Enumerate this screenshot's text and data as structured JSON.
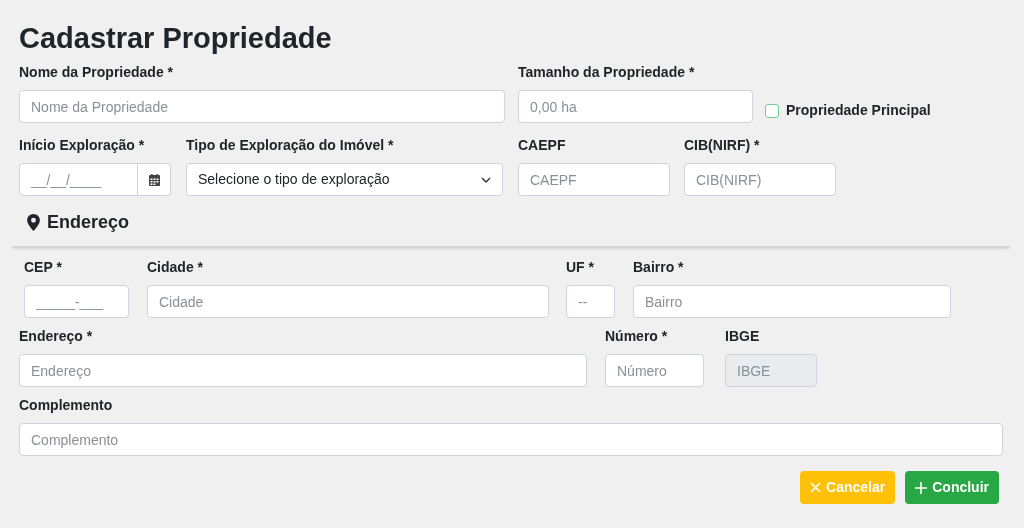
{
  "title": "Cadastrar Propriedade",
  "rows": [
    [
      {
        "kind": "text",
        "label": "Nome da Propriedade *",
        "placeholder": "Nome da Propriedade",
        "disabled": false
      },
      {
        "kind": "text",
        "label": "Tamanho da Propriedade *",
        "placeholder": "0,00 ha",
        "disabled": false
      },
      {
        "kind": "checkbox",
        "label": "Propriedade Principal",
        "checked": false
      }
    ],
    [
      {
        "kind": "date",
        "label": "Início Exploração *",
        "placeholder": "__/__/____",
        "disabled": false
      },
      {
        "kind": "select",
        "label": "Tipo de Exploração do Imóvel *",
        "value": "Selecione o tipo de exploração",
        "disabled": false
      },
      {
        "kind": "text",
        "label": "CAEPF",
        "placeholder": "CAEPF",
        "disabled": false
      },
      {
        "kind": "text",
        "label": "CIB(NIRF) *",
        "placeholder": "CIB(NIRF)",
        "disabled": false
      }
    ]
  ],
  "section": {
    "title": "Endereço"
  },
  "address_rows": [
    [
      {
        "kind": "text",
        "label": "CEP *",
        "placeholder": "_____-___",
        "disabled": false
      },
      {
        "kind": "text",
        "label": "Cidade *",
        "placeholder": "Cidade",
        "disabled": false
      },
      {
        "kind": "text",
        "label": "UF *",
        "placeholder": "--",
        "disabled": false
      },
      {
        "kind": "text",
        "label": "Bairro *",
        "placeholder": "Bairro",
        "disabled": false
      }
    ],
    [
      {
        "kind": "text",
        "label": "Endereço *",
        "placeholder": "Endereço",
        "disabled": false
      },
      {
        "kind": "text",
        "label": "Número *",
        "placeholder": "Número",
        "disabled": false
      },
      {
        "kind": "text",
        "label": "IBGE",
        "placeholder": "IBGE",
        "disabled": true
      }
    ],
    [
      {
        "kind": "text",
        "label": "Complemento",
        "placeholder": "Complemento",
        "disabled": false
      }
    ]
  ],
  "buttons": [
    {
      "kind": "cancel",
      "label": "Cancelar"
    },
    {
      "kind": "confirm",
      "label": "Concluir"
    }
  ]
}
